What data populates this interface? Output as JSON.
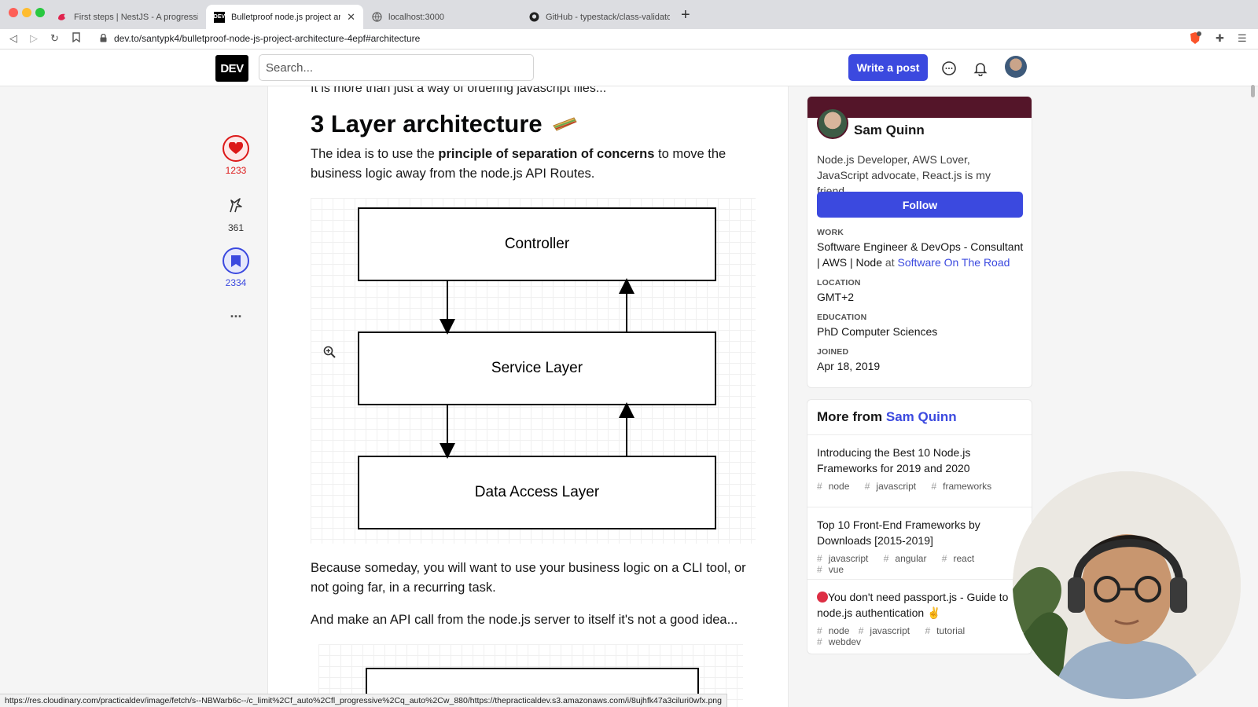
{
  "browser": {
    "tabs": [
      {
        "label": "First steps | NestJS - A progressive",
        "icon": "nestjs-icon"
      },
      {
        "label": "Bulletproof node.js project arch",
        "icon": "dev-icon"
      },
      {
        "label": "localhost:3000",
        "icon": "globe-icon"
      },
      {
        "label": "GitHub - typestack/class-validator:",
        "icon": "github-icon"
      }
    ],
    "url": "dev.to/santypk4/bulletproof-node-js-project-architecture-4epf#architecture",
    "status_url": "https://res.cloudinary.com/practicaldev/image/fetch/s--NBWarb6c--/c_limit%2Cf_auto%2Cfl_progressive%2Cq_auto%2Cw_880/https://thepracticaldev.s3.amazonaws.com/i/8ujhfk47a3ciluri0wfx.png"
  },
  "header": {
    "logo": "DEV",
    "search_placeholder": "Search...",
    "write_label": "Write a post"
  },
  "reactions": {
    "hearts": "1233",
    "unicorns": "361",
    "bookmarks": "2334",
    "more": "..."
  },
  "article": {
    "cut_line": "It is more than just a way of ordering javascript files...",
    "heading": "3 Layer architecture",
    "heading_emoji": "sandwich",
    "intro_before": "The idea is to use the ",
    "intro_bold": "principle of separation of concerns",
    "intro_after": " to move the business logic away from the node.js API Routes.",
    "diagram_boxes": [
      "Controller",
      "Service Layer",
      "Data Access Layer"
    ],
    "para2": "Because someday, you will want to use your business logic on a CLI tool, or not going far, in a recurring task.",
    "para3": "And make an API call from the node.js server to itself it's not a good idea..."
  },
  "profile": {
    "name": "Sam Quinn",
    "bio": "Node.js Developer, AWS Lover, JavaScript advocate, React.js is my friend.",
    "follow_label": "Follow",
    "work_label": "WORK",
    "work_value": "Software Engineer & DevOps - Consultant | AWS | Node",
    "work_at": "at",
    "work_company": "Software On The Road",
    "location_label": "LOCATION",
    "location_value": "GMT+2",
    "education_label": "EDUCATION",
    "education_value": "PhD Computer Sciences",
    "joined_label": "JOINED",
    "joined_value": "Apr 18, 2019",
    "banner_color": "#541529"
  },
  "more_from": {
    "heading_prefix": "More from",
    "author": "Sam Quinn",
    "items": [
      {
        "title": "Introducing the Best 10 Node.js Frameworks for 2019 and 2020",
        "tags": [
          "node",
          "javascript",
          "frameworks"
        ]
      },
      {
        "title": "Top 10 Front-End Frameworks by Downloads [2015-2019]",
        "tags": [
          "javascript",
          "angular",
          "react",
          "vue"
        ]
      },
      {
        "title": "You don't need passport.js - Guide to node.js authentication",
        "tags": [
          "javascript",
          "tutorial",
          "webdev"
        ],
        "prefix_icon": "red-circle-icon",
        "suffix_icon": "victory-hand-icon"
      }
    ]
  },
  "colors": {
    "accent": "#3b49df",
    "heart": "#dc1818"
  }
}
